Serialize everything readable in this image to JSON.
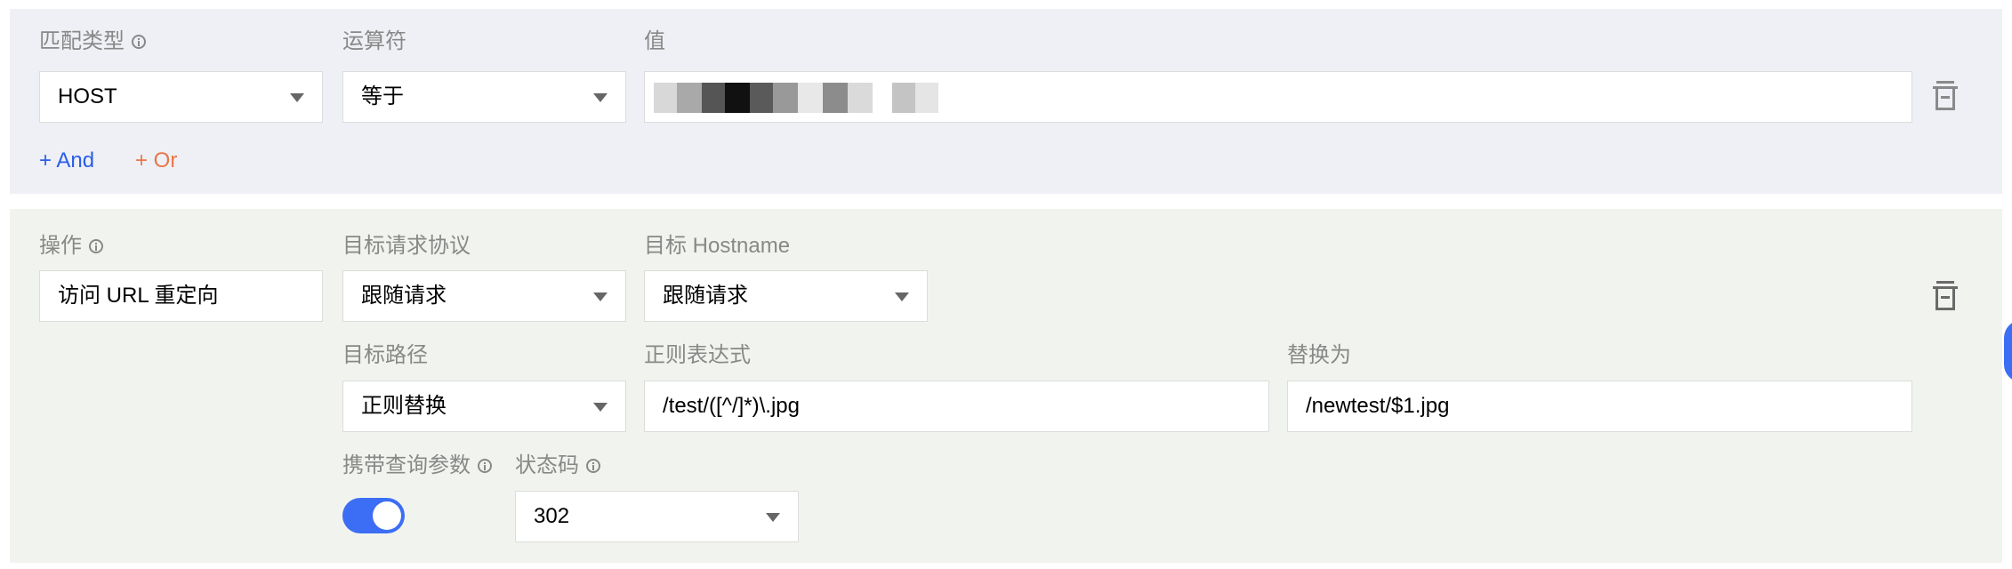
{
  "condition": {
    "match_type_label": "匹配类型",
    "operator_label": "运算符",
    "value_label": "值",
    "match_type_value": "HOST",
    "operator_value": "等于",
    "value_value": "",
    "add_and": "+ And",
    "add_or": "+ Or"
  },
  "action": {
    "operation_label": "操作",
    "operation_value": "访问 URL 重定向",
    "target_protocol_label": "目标请求协议",
    "target_protocol_value": "跟随请求",
    "target_hostname_label": "目标 Hostname",
    "target_hostname_value": "跟随请求",
    "target_path_label": "目标路径",
    "target_path_value": "正则替换",
    "regex_label": "正则表达式",
    "regex_value": "/test/([^/]*)\\.jpg",
    "replace_label": "替换为",
    "replace_value": "/newtest/$1.jpg",
    "carry_query_label": "携带查询参数",
    "carry_query_enabled": true,
    "status_code_label": "状态码",
    "status_code_value": "302"
  },
  "colors": {
    "accent_blue": "#3c6df5",
    "and_link": "#2a5ee8",
    "or_link": "#e8764a"
  }
}
